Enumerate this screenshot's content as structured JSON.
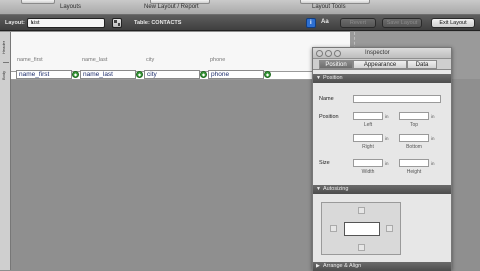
{
  "toolbar": {
    "layouts_label": "Layouts",
    "new_layout_label": "New Layout / Report",
    "layout_tools_label": "Layout Tools"
  },
  "layout_bar": {
    "layout_label": "Layout:",
    "layout_value": "List",
    "table_label": "Table: CONTACTS",
    "aa_label": "Aa",
    "revert_label": "Revert",
    "save_label": "Save Layout",
    "exit_label": "Exit Layout"
  },
  "ruler": {
    "header_tab": "Header",
    "body_tab": "Body"
  },
  "columns": [
    {
      "header": "name_first",
      "field": "name_first"
    },
    {
      "header": "name_last",
      "field": "name_last"
    },
    {
      "header": "city",
      "field": "city"
    },
    {
      "header": "phone",
      "field": "phone"
    }
  ],
  "inspector": {
    "title": "Inspector",
    "tabs": [
      "Position",
      "Appearance",
      "Data"
    ],
    "selected_tab": "Position",
    "sections": {
      "position": "Position",
      "autosizing": "Autosizing",
      "arrange": "Arrange & Align"
    },
    "name_label": "Name",
    "position_label": "Position",
    "size_label": "Size",
    "unit": "in",
    "sub_labels": {
      "left": "Left",
      "top": "Top",
      "right": "Right",
      "bottom": "Bottom",
      "width": "Width",
      "height": "Height"
    }
  },
  "colors": {
    "canvas_bg": "#8f8f8f",
    "field_text": "#1d2d6b",
    "field_badge": "#3c9b3c",
    "tab_selected": "#7a7a7a"
  }
}
